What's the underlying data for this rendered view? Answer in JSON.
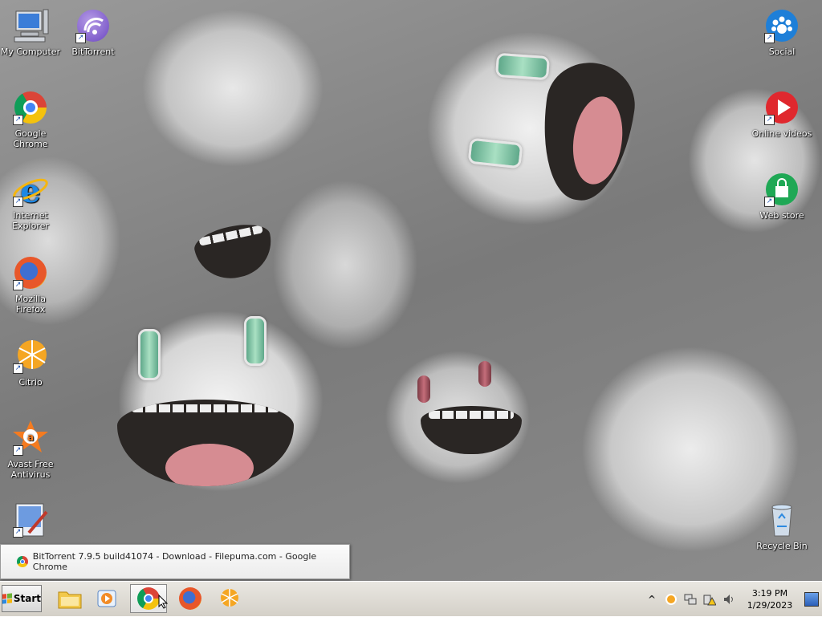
{
  "desktop_icons_left": [
    {
      "label": "My Computer",
      "icon": "computer-icon"
    },
    {
      "label": "BitTorrent",
      "icon": "bittorrent-icon"
    },
    {
      "label": "Google Chrome",
      "icon": "chrome-icon"
    },
    {
      "label": "Internet Explorer",
      "icon": "internet-explorer-icon"
    },
    {
      "label": "Mozilla Firefox",
      "icon": "firefox-icon"
    },
    {
      "label": "Citrio",
      "icon": "citrio-icon"
    },
    {
      "label": "Avast Free Antivirus",
      "icon": "avast-icon"
    },
    {
      "label": "",
      "icon": "paint-icon"
    }
  ],
  "desktop_icons_right": [
    {
      "label": "Social",
      "icon": "social-icon"
    },
    {
      "label": "Online videos",
      "icon": "play-icon"
    },
    {
      "label": "Web store",
      "icon": "shopping-bag-icon"
    },
    {
      "label": "Recycle Bin",
      "icon": "recycle-bin-icon"
    }
  ],
  "preview": {
    "title": "BitTorrent 7.9.5 build41074 - Download - Filepuma.com - Google Chrome"
  },
  "taskbar": {
    "start_label": "Start",
    "pinned": [
      "folder-icon",
      "media-player-icon",
      "chrome-icon",
      "firefox-icon",
      "citrio-icon"
    ]
  },
  "tray": {
    "time": "3:19 PM",
    "date": "1/29/2023",
    "expand_glyph": "^"
  },
  "colors": {
    "taskbar": "#d4d0c8",
    "chrome_red": "#db4437",
    "chrome_yellow": "#f4c20d",
    "chrome_green": "#0f9d58",
    "chrome_blue": "#4285f4"
  }
}
